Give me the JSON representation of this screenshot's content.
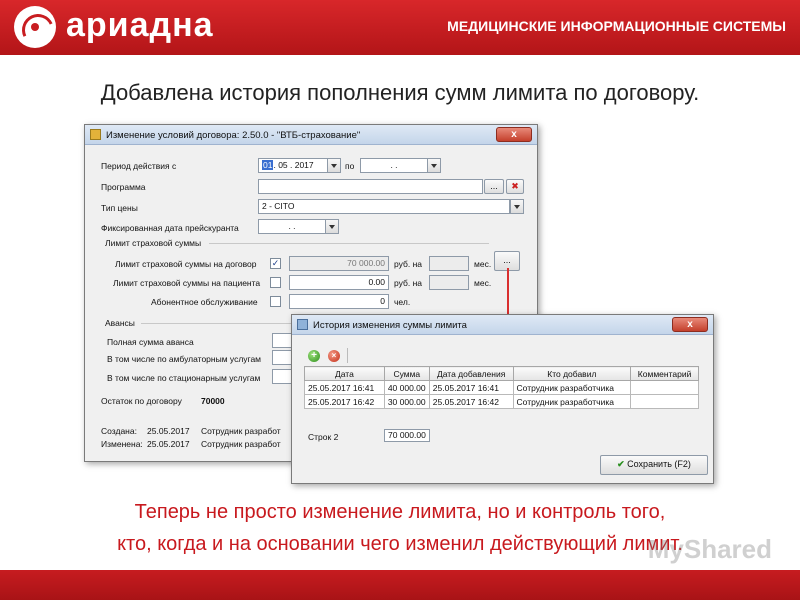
{
  "header": {
    "brand": "ариадна",
    "tagline": "МЕДИЦИНСКИЕ ИНФОРМАЦИОННЫЕ СИСТЕМЫ"
  },
  "headline": "Добавлена история пополнения сумм лимита по договору.",
  "main_window": {
    "title": "Изменение условий договора: 2.50.0 - \"ВТБ-страхование\"",
    "close_label": "x",
    "period_label": "Период действия с",
    "period_day": "01",
    "period_rest": ". 05 . 2017",
    "period_to_label": "по",
    "period_to_value": ". .",
    "program_label": "Программа",
    "program_value": "",
    "browse_label": "...",
    "clear_label": "✖",
    "price_type_label": "Тип цены",
    "price_type_value": "2 - CITO",
    "fixed_date_label": "Фиксированная дата прейскуранта",
    "fixed_date_value": ". .",
    "limit_group_label": "Лимит страховой суммы",
    "limit_contract_label": "Лимит страховой суммы на договор",
    "limit_contract_value": "70 000.00",
    "limit_contract_checked": "✓",
    "limit_patient_label": "Лимит страховой суммы на пациента",
    "limit_patient_value": "0.00",
    "subscription_label": "Абонентное обслуживание",
    "subscription_value": "0",
    "unit_rub": "руб. на",
    "unit_month": "мес.",
    "unit_persons": "чел.",
    "history_button_label": "...",
    "advances_label": "Авансы",
    "advance_total_label": "Полная сумма аванса",
    "advance_ambulatory_label": "В том числе по амбулаторным услугам",
    "advance_inpatient_label": "В том числе по стационарным услугам",
    "balance_label": "Остаток по договору",
    "balance_value": "70000",
    "created_label": "Создана:",
    "created_date": "25.05.2017",
    "created_user": "Сотрудник разработ",
    "modified_label": "Изменена:",
    "modified_date": "25.05.2017",
    "modified_user": "Сотрудник разработ"
  },
  "history_window": {
    "title": "История изменения суммы лимита",
    "close_label": "x",
    "columns": [
      "Дата",
      "Сумма",
      "Дата добавления",
      "Кто добавил",
      "Комментарий"
    ],
    "rows": [
      [
        "25.05.2017 16:41",
        "40 000.00",
        "25.05.2017 16:41",
        "Сотрудник разработчика",
        ""
      ],
      [
        "25.05.2017 16:42",
        "30 000.00",
        "25.05.2017 16:42",
        "Сотрудник разработчика",
        ""
      ]
    ],
    "rows_label": "Строк 2",
    "total_value": "70 000.00",
    "save_label": "Сохранить (F2)"
  },
  "footer": {
    "line1": "Теперь не просто изменение лимита, но и контроль того,",
    "line2": "кто, когда и на основании чего изменил действующий лимит."
  },
  "watermark": "MyShared",
  "colors": {
    "brand_red": "#c81d21",
    "accent_text_red": "#c8191e"
  }
}
